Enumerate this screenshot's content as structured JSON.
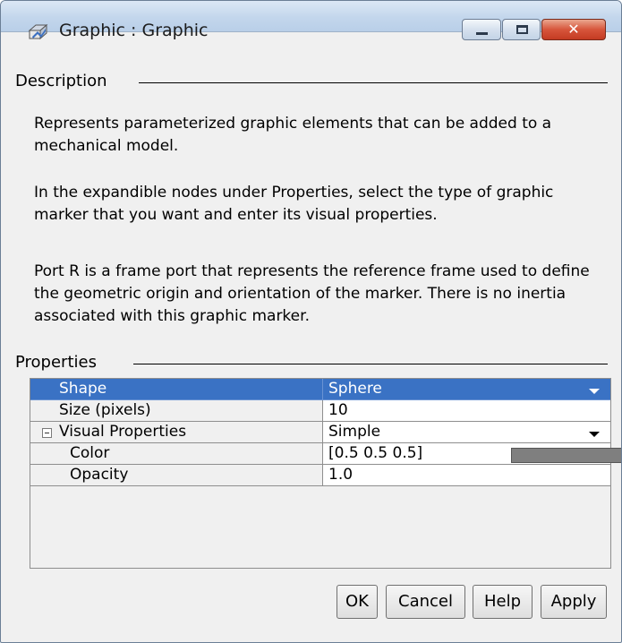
{
  "window": {
    "title": "Graphic : Graphic",
    "close_glyph": "✕"
  },
  "description": {
    "header": "Description",
    "paragraphs": [
      "Represents parameterized graphic elements that can be added to a mechanical model.",
      "In the expandible nodes under Properties, select the type of graphic marker that you want and enter its visual properties.",
      "Port R is a frame port that represents the reference frame used to define the geometric origin and orientation of the marker. There is no inertia associated with this graphic marker."
    ]
  },
  "properties": {
    "header": "Properties",
    "rows": [
      {
        "name": "Shape",
        "value": "Sphere"
      },
      {
        "name": "Size (pixels)",
        "value": "10"
      },
      {
        "name": "Visual Properties",
        "value": "Simple"
      },
      {
        "name": "Color",
        "value": "[0.5 0.5 0.5]"
      },
      {
        "name": "Opacity",
        "value": "1.0"
      }
    ],
    "color_swatch": "#7f7f7f",
    "selection_color": "#3a72c4"
  },
  "buttons": {
    "ok": "OK",
    "cancel": "Cancel",
    "help": "Help",
    "apply": "Apply"
  }
}
